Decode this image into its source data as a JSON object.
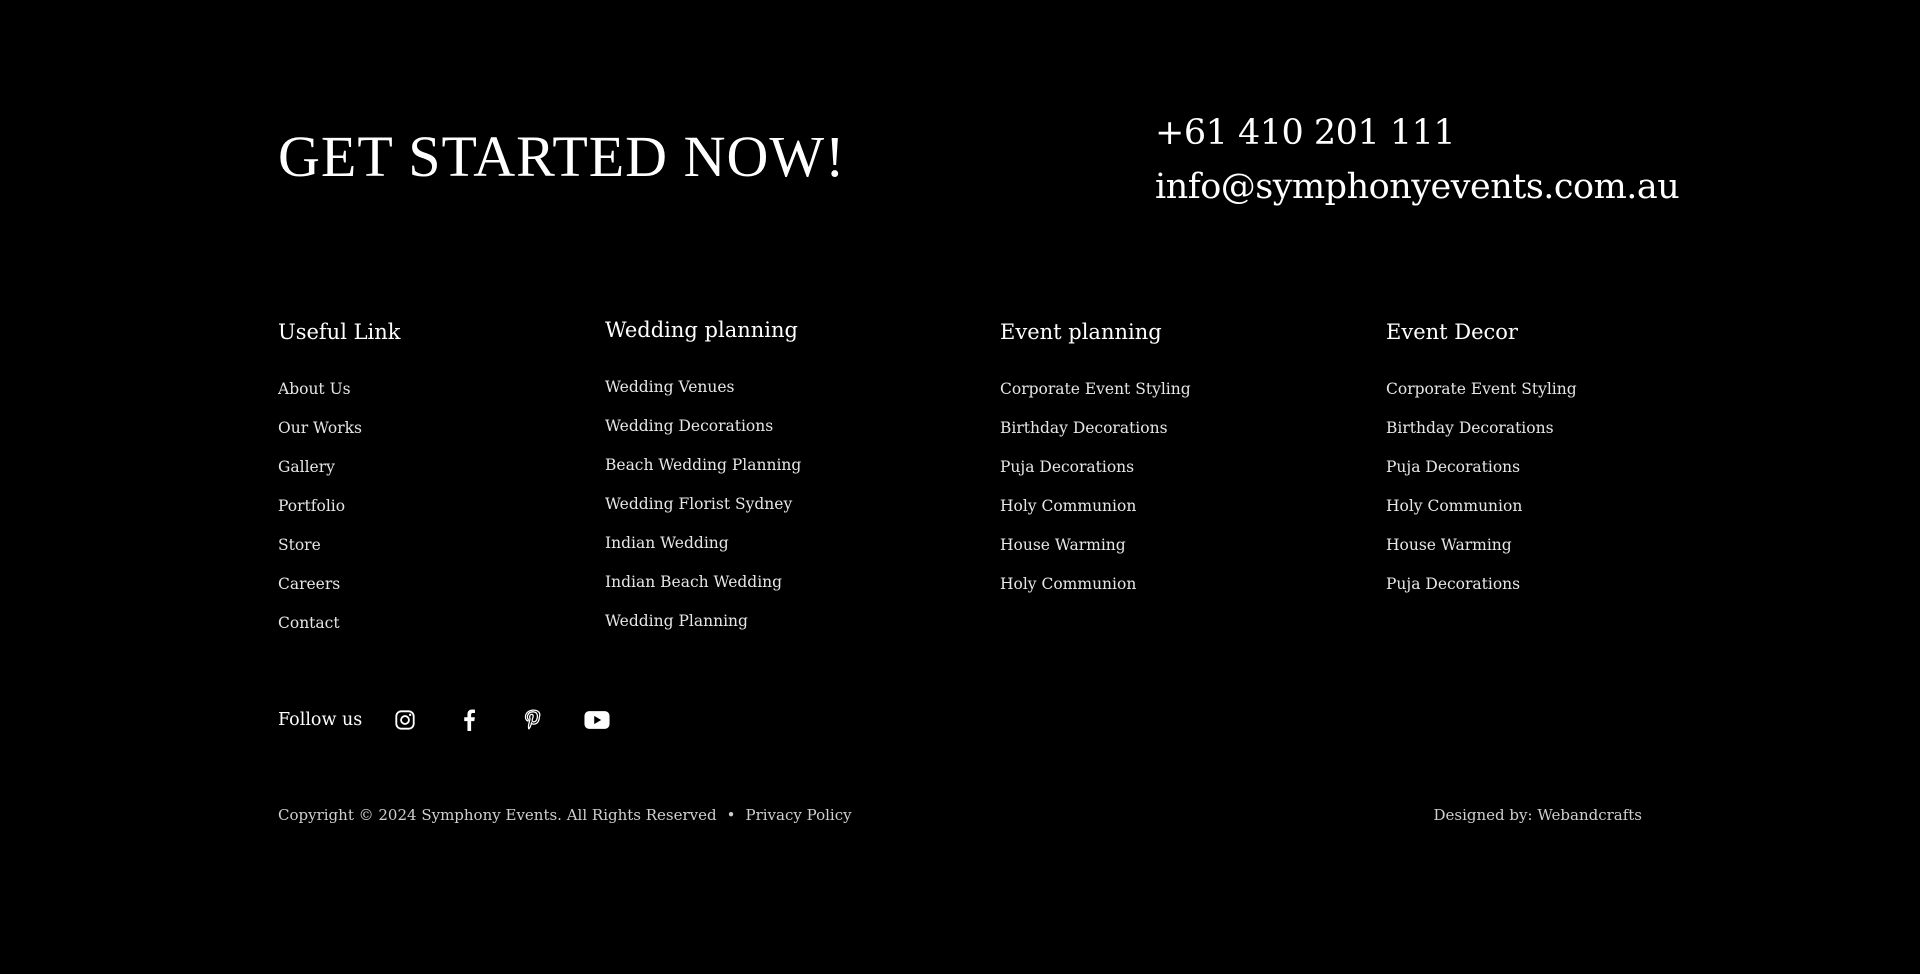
{
  "cta": {
    "title": "GET STARTED NOW!",
    "phone": "+61 410 201 111",
    "email": "info@symphonyevents.com.au"
  },
  "columns": [
    {
      "heading": "Useful Link",
      "links": [
        "About Us",
        "Our Works",
        "Gallery",
        "Portfolio",
        "Store",
        "Careers",
        "Contact"
      ]
    },
    {
      "heading": "Wedding planning",
      "links": [
        "Wedding Venues",
        "Wedding Decorations",
        "Beach Wedding Planning",
        "Wedding Florist Sydney",
        "Indian Wedding",
        "Indian Beach Wedding",
        "Wedding Planning"
      ]
    },
    {
      "heading": "Event planning",
      "links": [
        "Corporate Event Styling",
        "Birthday Decorations",
        "Puja Decorations",
        "Holy Communion",
        "House Warming",
        "Holy Communion"
      ]
    },
    {
      "heading": "Event Decor",
      "links": [
        "Corporate Event Styling",
        "Birthday Decorations",
        "Puja Decorations",
        "Holy Communion",
        "House Warming",
        "Puja Decorations"
      ]
    }
  ],
  "follow": {
    "label": "Follow us",
    "icons": [
      "instagram-icon",
      "facebook-icon",
      "pinterest-icon",
      "youtube-icon"
    ]
  },
  "footer": {
    "copyright": "Copyright © 2024 Symphony Events. All Rights Reserved",
    "separator": "•",
    "privacy": "Privacy Policy",
    "designed_by_prefix": "Designed by:",
    "designed_by_name": "Webandcrafts"
  },
  "colors": {
    "background": "#000000",
    "text": "#ffffff",
    "muted_text": "#cfcfcf"
  }
}
